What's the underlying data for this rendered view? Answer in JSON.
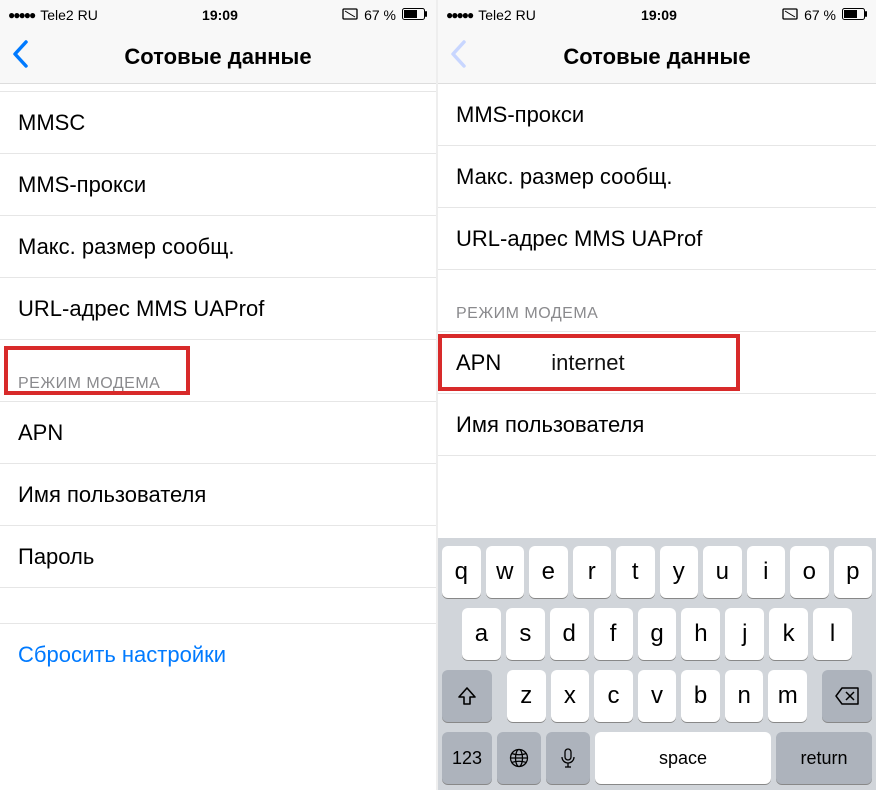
{
  "status": {
    "carrier": "Tele2 RU",
    "time": "19:09",
    "battery": "67 %"
  },
  "nav": {
    "title": "Сотовые данные"
  },
  "left": {
    "rows": {
      "mmsc": "MMSC",
      "mms_proxy": "MMS-прокси",
      "max_size": "Макс. размер сообщ.",
      "ua_prof": "URL-адрес MMS UAProf",
      "section_modem": "РЕЖИМ МОДЕМА",
      "apn": "APN",
      "username": "Имя пользователя",
      "password": "Пароль",
      "reset": "Сбросить настройки"
    }
  },
  "right": {
    "rows": {
      "mms_proxy": "MMS-прокси",
      "max_size": "Макс. размер сообщ.",
      "ua_prof": "URL-адрес MMS UAProf",
      "section_modem": "РЕЖИМ МОДЕМА",
      "apn_label": "APN",
      "apn_value": "internet",
      "username": "Имя пользователя"
    }
  },
  "keyboard": {
    "row1": [
      "q",
      "w",
      "e",
      "r",
      "t",
      "y",
      "u",
      "i",
      "o",
      "p"
    ],
    "row2": [
      "a",
      "s",
      "d",
      "f",
      "g",
      "h",
      "j",
      "k",
      "l"
    ],
    "row3": [
      "z",
      "x",
      "c",
      "v",
      "b",
      "n",
      "m"
    ],
    "num": "123",
    "space": "space",
    "return": "return"
  }
}
